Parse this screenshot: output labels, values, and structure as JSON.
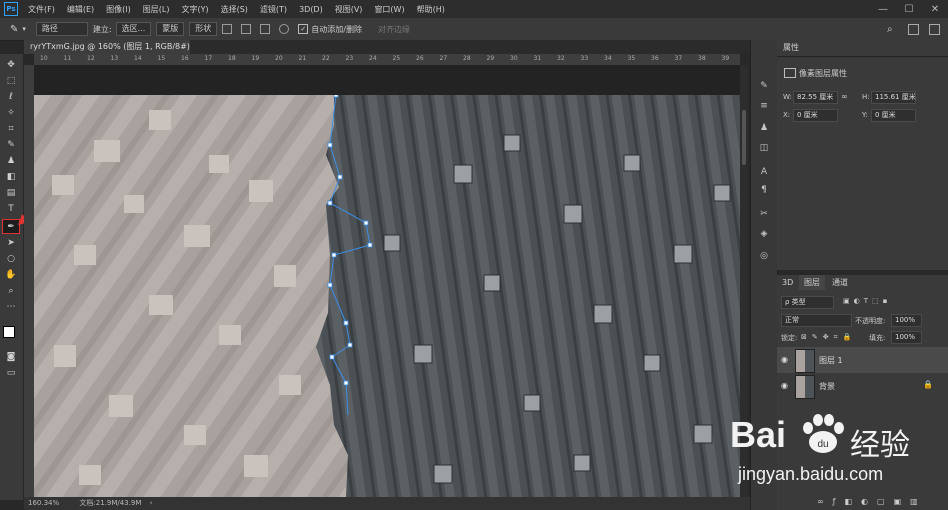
{
  "menubar": {
    "logo": "Ps",
    "items": [
      "文件(F)",
      "编辑(E)",
      "图像(I)",
      "图层(L)",
      "文字(Y)",
      "选择(S)",
      "滤镜(T)",
      "3D(D)",
      "视图(V)",
      "窗口(W)",
      "帮助(H)"
    ],
    "window_controls": [
      "—",
      "☐",
      "✕"
    ]
  },
  "options": {
    "mode": "路径",
    "make_label": "建立:",
    "selection_btn": "选区...",
    "mask_btn": "蒙版",
    "shape_btn": "形状",
    "auto_add_delete": "自动添加/删除",
    "align_edges": "对齐边缘"
  },
  "document": {
    "tab_title": "ryrYTxmG.jpg @ 160% (图层 1, RGB/8#) *",
    "close": "×"
  },
  "ruler": {
    "top_ticks": [
      "10",
      "11",
      "12",
      "13",
      "14",
      "15",
      "16",
      "17",
      "18",
      "19",
      "20",
      "21",
      "22",
      "23",
      "24",
      "25",
      "26",
      "27",
      "28",
      "29",
      "30",
      "31",
      "32",
      "33",
      "34",
      "35",
      "36",
      "37",
      "38",
      "39"
    ]
  },
  "status": {
    "zoom": "160.34%",
    "doc": "文档:21.9M/43.9M"
  },
  "properties": {
    "tab": "属性",
    "header": "像素图层属性",
    "w_label": "W:",
    "w_value": "82.55 厘米",
    "h_label": "H:",
    "h_value": "115.61 厘米",
    "x_label": "X:",
    "x_value": "0 厘米",
    "y_label": "Y:",
    "y_value": "0 厘米"
  },
  "layers": {
    "tabs": [
      "3D",
      "图层",
      "通道"
    ],
    "filter": "ρ 类型",
    "blend_mode": "正常",
    "opacity_label": "不透明度:",
    "opacity_value": "100%",
    "lock_label": "锁定:",
    "fill_label": "填充:",
    "fill_value": "100%",
    "items": [
      {
        "name": "图层 1",
        "selected": true
      },
      {
        "name": "背景",
        "selected": false
      }
    ],
    "bottom_icons": [
      "link-icon",
      "fx-icon",
      "mask-icon",
      "adjustment-icon",
      "group-icon",
      "new-layer-icon",
      "trash-icon"
    ]
  },
  "watermark": {
    "brand_left": "Bai",
    "brand_right": "经验",
    "url": "jingyan.baidu.com"
  },
  "colors": {
    "accent": "#2fa3ff",
    "highlight": "#dd3333",
    "path": "#3b8fe8"
  }
}
